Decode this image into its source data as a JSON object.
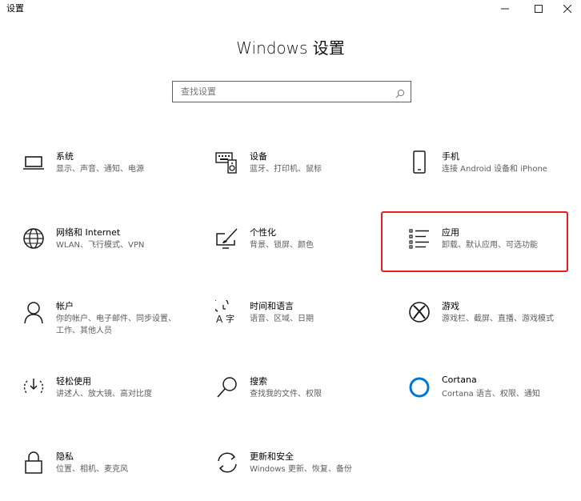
{
  "window": {
    "title": "设置",
    "minimize": "—",
    "maximize": "☐",
    "close": "✕"
  },
  "header": {
    "title": "Windows 设置"
  },
  "search": {
    "placeholder": "查找设置",
    "value": ""
  },
  "tiles": [
    {
      "name": "系统",
      "desc": "显示、声音、通知、电源",
      "icon": "laptop-icon"
    },
    {
      "name": "设备",
      "desc": "蓝牙、打印机、鼠标",
      "icon": "keyboard-speaker-icon"
    },
    {
      "name": "手机",
      "desc": "连接 Android 设备和 iPhone",
      "icon": "phone-icon"
    },
    {
      "name": "网络和 Internet",
      "desc": "WLAN、飞行模式、VPN",
      "icon": "globe-icon"
    },
    {
      "name": "个性化",
      "desc": "背景、锁屏、颜色",
      "icon": "brush-screen-icon"
    },
    {
      "name": "应用",
      "desc": "卸载、默认应用、可选功能",
      "icon": "app-list-icon"
    },
    {
      "name": "帐户",
      "desc": "你的帐户、电子邮件、同步设置、工作、其他人员",
      "icon": "person-icon"
    },
    {
      "name": "时间和语言",
      "desc": "语音、区域、日期",
      "icon": "time-language-icon"
    },
    {
      "name": "游戏",
      "desc": "游戏栏、截屏、直播、游戏模式",
      "icon": "xbox-icon"
    },
    {
      "name": "轻松使用",
      "desc": "讲述人、放大镜、高对比度",
      "icon": "ease-of-access-icon"
    },
    {
      "name": "搜索",
      "desc": "查找我的文件、权限",
      "icon": "search-icon"
    },
    {
      "name": "Cortana",
      "desc": "Cortana 语言、权限、通知",
      "icon": "cortana-ring-icon"
    },
    {
      "name": "隐私",
      "desc": "位置、相机、麦克风",
      "icon": "lock-icon"
    },
    {
      "name": "更新和安全",
      "desc": "Windows 更新、恢复、备份",
      "icon": "sync-icon"
    }
  ],
  "colors": {
    "accent": "#0078d7",
    "highlight": "#e81e1e",
    "icon": "#1a1a1a"
  }
}
